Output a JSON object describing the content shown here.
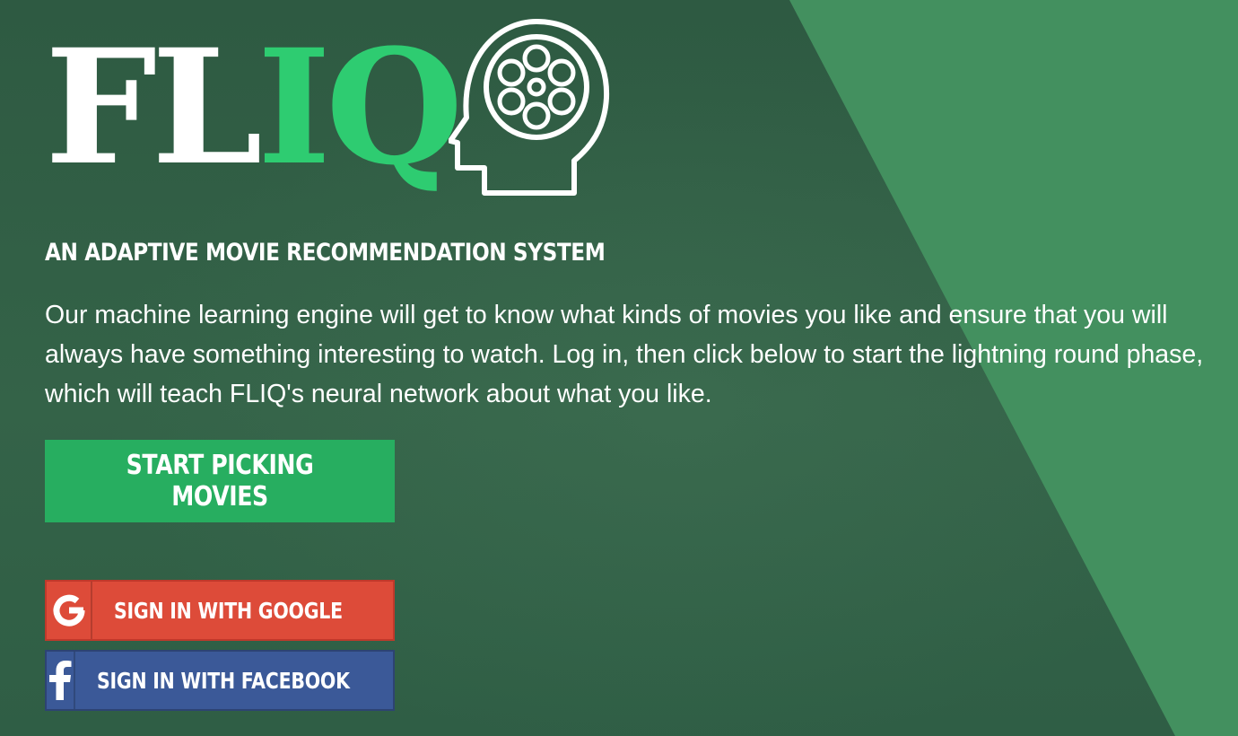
{
  "logo": {
    "text_white": "FL",
    "text_green": "IQ",
    "icon": "head-film-reel-icon"
  },
  "hero": {
    "headline": "AN ADAPTIVE MOVIE RECOMMENDATION SYSTEM",
    "description": "Our machine learning engine will get to know what kinds of movies you like and ensure that you will always have something interesting to watch. Log in, then click below to start the lightning round phase, which will teach FLIQ's neural network about what you like."
  },
  "actions": {
    "start_label": "START PICKING MOVIES",
    "google_label": "SIGN IN WITH GOOGLE",
    "google_icon": "google-g-icon",
    "facebook_label": "SIGN IN WITH FACEBOOK",
    "facebook_icon": "facebook-f-icon"
  },
  "colors": {
    "background": "#2f5b44",
    "accent_stripe": "#43905f",
    "brand_green": "#2ecc71",
    "start_button": "#27ae60",
    "google": "#dd4b39",
    "facebook": "#3b5998"
  }
}
